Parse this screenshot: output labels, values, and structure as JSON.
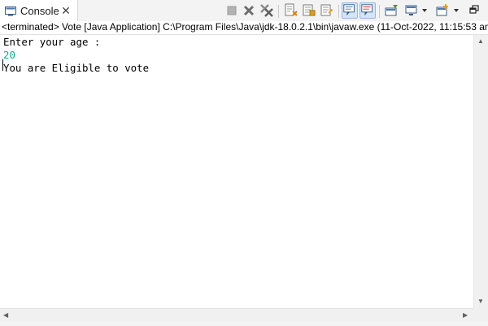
{
  "tab": {
    "label": "Console",
    "icon": "console-icon",
    "close_icon": "close-icon"
  },
  "toolbar": {
    "buttons": [
      {
        "name": "terminate-button",
        "icon": "stop-square-icon"
      },
      {
        "name": "remove-launch-button",
        "icon": "grey-x-icon"
      },
      {
        "name": "remove-all-terminated-button",
        "icon": "double-grey-x-icon"
      },
      {
        "name": "clear-console-button",
        "icon": "clear-console-icon"
      },
      {
        "name": "scroll-lock-button",
        "icon": "scroll-lock-icon"
      },
      {
        "name": "word-wrap-button",
        "icon": "word-wrap-icon"
      },
      {
        "name": "show-console-on-stdout-button",
        "icon": "console-stdout-icon"
      },
      {
        "name": "show-console-on-stderr-button",
        "icon": "console-stderr-icon"
      },
      {
        "name": "pin-console-button",
        "icon": "pin-icon"
      },
      {
        "name": "display-selected-console-button",
        "icon": "monitor-icon"
      },
      {
        "name": "open-console-button",
        "icon": "new-console-icon"
      },
      {
        "name": "minimize-button",
        "icon": "restore-icon"
      }
    ]
  },
  "info": {
    "text": "<terminated> Vote [Java Application] C:\\Program Files\\Java\\jdk-18.0.2.1\\bin\\javaw.exe  (11-Oct-2022, 11:15:53 am"
  },
  "console": {
    "lines": [
      {
        "text": "Enter your age :",
        "kind": "output"
      },
      {
        "text": "20",
        "kind": "input"
      },
      {
        "text": "You are Eligible to vote",
        "kind": "output"
      }
    ]
  },
  "colors": {
    "input_text": "#1aa68f",
    "pressed_button": "#d4e4f7"
  }
}
